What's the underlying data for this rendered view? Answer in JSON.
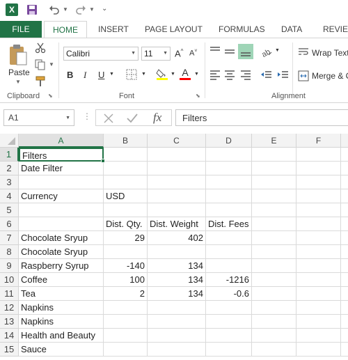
{
  "qat": {
    "logo": "X",
    "icons": [
      "excel-logo-icon",
      "save-icon",
      "undo-icon",
      "redo-icon",
      "customize-qat-icon"
    ]
  },
  "tabs": [
    "FILE",
    "HOME",
    "INSERT",
    "PAGE LAYOUT",
    "FORMULAS",
    "DATA",
    "REVIEW"
  ],
  "ribbon": {
    "clipboard": {
      "paste_label": "Paste",
      "group_label": "Clipboard"
    },
    "font": {
      "font_name": "Calibri",
      "font_size": "11",
      "grow_label": "A",
      "shrink_label": "A",
      "bold": "B",
      "italic": "I",
      "underline": "U",
      "group_label": "Font",
      "highlight_color": "#ffff00",
      "font_color": "#ff0000"
    },
    "alignment": {
      "wrap_text": "Wrap Text",
      "merge_center": "Merge & C",
      "group_label": "Alignment"
    }
  },
  "formula_bar": {
    "name_box": "A1",
    "fx_label": "fx",
    "content": "Filters"
  },
  "columns": [
    "A",
    "B",
    "C",
    "D",
    "E",
    "F"
  ],
  "rows": [
    {
      "num": "1",
      "a": "Filters",
      "b": "",
      "c": "",
      "d": ""
    },
    {
      "num": "2",
      "a": "Date Filter",
      "b": "",
      "c": "",
      "d": ""
    },
    {
      "num": "3",
      "a": "",
      "b": "",
      "c": "",
      "d": ""
    },
    {
      "num": "4",
      "a": "Currency",
      "b": "USD",
      "c": "",
      "d": ""
    },
    {
      "num": "5",
      "a": "",
      "b": "",
      "c": "",
      "d": ""
    },
    {
      "num": "6",
      "a": "",
      "b": "Dist. Qty.",
      "c": "Dist. Weight",
      "d": "Dist. Fees"
    },
    {
      "num": "7",
      "a": "Chocolate Sryup",
      "b": "29",
      "c": "402",
      "d": ""
    },
    {
      "num": "8",
      "a": "Chocolate Sryup",
      "b": "",
      "c": "",
      "d": ""
    },
    {
      "num": "9",
      "a": "Raspberry Syrup",
      "b": "-140",
      "c": "134",
      "d": ""
    },
    {
      "num": "10",
      "a": "Coffee",
      "b": "100",
      "c": "134",
      "d": "-1216"
    },
    {
      "num": "11",
      "a": "Tea",
      "b": "2",
      "c": "134",
      "d": "-0.6"
    },
    {
      "num": "12",
      "a": "Napkins",
      "b": "",
      "c": "",
      "d": ""
    },
    {
      "num": "13",
      "a": "Napkins",
      "b": "",
      "c": "",
      "d": ""
    },
    {
      "num": "14",
      "a": "Health and Beauty",
      "b": "",
      "c": "",
      "d": ""
    },
    {
      "num": "15",
      "a": "Sauce",
      "b": "",
      "c": "",
      "d": ""
    }
  ],
  "colors": {
    "accent": "#217346",
    "header_bg": "#f3f3f3",
    "selected_header_bg": "#e1e1e1",
    "gridline": "#dadada"
  }
}
